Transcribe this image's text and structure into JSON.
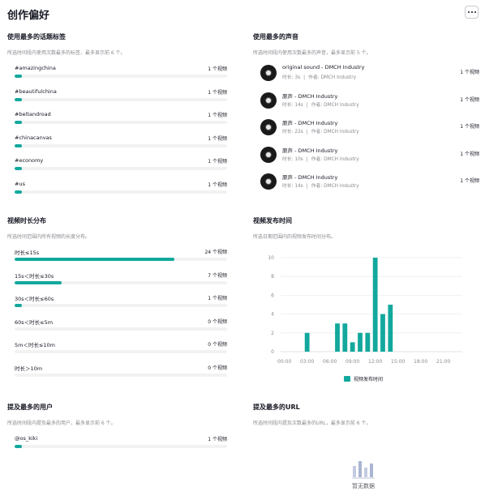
{
  "page": {
    "title": "创作偏好"
  },
  "hashtags": {
    "title": "使用最多的话题标签",
    "desc": "所选时间段内使用次数最多的标签，最多显示前 6 个。",
    "items": [
      {
        "label": "#amazingchina",
        "value": "1 个视频",
        "fraction": 0.035
      },
      {
        "label": "#beautifulchina",
        "value": "1 个视频",
        "fraction": 0.035
      },
      {
        "label": "#beltandroad",
        "value": "1 个视频",
        "fraction": 0.035
      },
      {
        "label": "#chinacanvas",
        "value": "1 个视频",
        "fraction": 0.035
      },
      {
        "label": "#economy",
        "value": "1 个视频",
        "fraction": 0.035
      },
      {
        "label": "#us",
        "value": "1 个视频",
        "fraction": 0.035
      }
    ]
  },
  "sounds": {
    "title": "使用最多的声音",
    "desc": "所选时间段内使用次数最多的声音，最多显示前 5 个。",
    "items": [
      {
        "name": "original sound - DMCH Industry",
        "duration": "时长: 3s",
        "author": "作者: DMCH Industry",
        "value": "1 个视频"
      },
      {
        "name": "原声 - DMCH Industry",
        "duration": "时长: 14s",
        "author": "作者: DMCH Industry",
        "value": "1 个视频"
      },
      {
        "name": "原声 - DMCH Industry",
        "duration": "时长: 22s",
        "author": "作者: DMCH Industry",
        "value": "1 个视频"
      },
      {
        "name": "原声 - DMCH Industry",
        "duration": "时长: 10s",
        "author": "作者: DMCH Industry",
        "value": "1 个视频"
      },
      {
        "name": "原声 - DMCH Industry",
        "duration": "时长: 14s",
        "author": "作者: DMCH Industry",
        "value": "1 个视频"
      }
    ]
  },
  "durations": {
    "title": "视频时长分布",
    "desc": "所选时间范围内所有视频的长度分布。",
    "items": [
      {
        "label": "时长≤15s",
        "value": "24 个视频",
        "fraction": 0.75
      },
      {
        "label": "15s＜时长≤30s",
        "value": "7 个视频",
        "fraction": 0.22
      },
      {
        "label": "30s＜时长≤60s",
        "value": "1 个视频",
        "fraction": 0.035
      },
      {
        "label": "60s＜时长≤5m",
        "value": "0 个视频",
        "fraction": 0
      },
      {
        "label": "5m＜时长≤10m",
        "value": "0 个视频",
        "fraction": 0
      },
      {
        "label": "时长＞10m",
        "value": "0 个视频",
        "fraction": 0
      }
    ]
  },
  "publish": {
    "title": "视频发布时间",
    "desc": "所选日期范围内的视频发布时间分布。",
    "legend": "视频发布时间"
  },
  "chart_data": {
    "type": "bar",
    "x": [
      0,
      1,
      2,
      3,
      4,
      5,
      6,
      7,
      8,
      9,
      10,
      11,
      12,
      13,
      14,
      15,
      16,
      17,
      18,
      19,
      20,
      21,
      22,
      23
    ],
    "xticks": [
      "00:00",
      "03:00",
      "06:00",
      "09:00",
      "12:00",
      "15:00",
      "18:00",
      "21:00"
    ],
    "values": [
      0,
      0,
      0,
      2,
      0,
      0,
      0,
      3,
      3,
      1,
      2,
      2,
      10,
      4,
      5,
      0,
      0,
      0,
      0,
      0,
      0,
      0,
      0,
      0
    ],
    "series_name": "视频发布时间",
    "yticks": [
      0,
      2,
      4,
      6,
      8,
      10
    ],
    "ylim": [
      0,
      10
    ],
    "grid": true,
    "legend": "bottom",
    "color": "#12a89d"
  },
  "users": {
    "title": "提及最多的用户",
    "desc": "所选时间段内提及最多的用户，最多显示前 6 个。",
    "items": [
      {
        "label": "@os_kiki",
        "value": "1 个视频",
        "fraction": 0.035
      }
    ]
  },
  "urls": {
    "title": "提及最多的URL",
    "desc": "所选时间段内提及次数最多的URL，最多显示前 6 个。",
    "empty": "暂无数据"
  },
  "colors": {
    "accent": "#12a89d",
    "track": "#f2f2f3",
    "muted": "#8a8b91"
  }
}
